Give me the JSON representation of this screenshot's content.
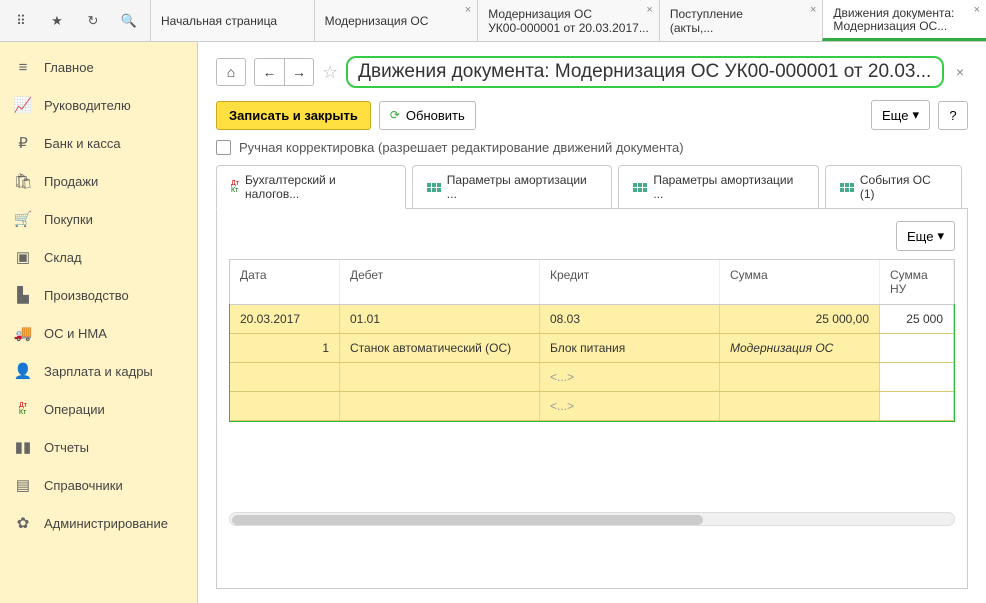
{
  "tabs": {
    "t0": {
      "l1": "Начальная страница",
      "l2": ""
    },
    "t1": {
      "l1": "Модернизация ОС",
      "l2": ""
    },
    "t2": {
      "l1": "Модернизация ОС",
      "l2": "УК00-000001 от 20.03.2017..."
    },
    "t3": {
      "l1": "Поступление",
      "l2": "(акты,..."
    },
    "t4": {
      "l1": "Движения документа:",
      "l2": "Модернизация ОС..."
    }
  },
  "sidebar": {
    "items": [
      {
        "label": "Главное",
        "icon": "≡"
      },
      {
        "label": "Руководителю",
        "icon": "↗"
      },
      {
        "label": "Банк и касса",
        "icon": "₽"
      },
      {
        "label": "Продажи",
        "icon": "🛍"
      },
      {
        "label": "Покупки",
        "icon": "🛒"
      },
      {
        "label": "Склад",
        "icon": "📦"
      },
      {
        "label": "Производство",
        "icon": "🏭"
      },
      {
        "label": "ОС и НМА",
        "icon": "🚚"
      },
      {
        "label": "Зарплата и кадры",
        "icon": "👤"
      },
      {
        "label": "Операции",
        "icon": "ДтКт"
      },
      {
        "label": "Отчеты",
        "icon": "📊"
      },
      {
        "label": "Справочники",
        "icon": "📁"
      },
      {
        "label": "Администрирование",
        "icon": "⚙"
      }
    ]
  },
  "page": {
    "title": "Движения документа: Модернизация ОС УК00-000001 от 20.03...",
    "save_close": "Записать и закрыть",
    "refresh": "Обновить",
    "more": "Еще",
    "help": "?",
    "manual_edit": "Ручная корректировка (разрешает редактирование движений документа)"
  },
  "subtabs": {
    "t0": "Бухгалтерский и налогов...",
    "t1": "Параметры амортизации ...",
    "t2": "Параметры амортизации ...",
    "t3": "События ОС (1)"
  },
  "table": {
    "more": "Еще",
    "headers": {
      "c1": "Дата",
      "c2": "Дебет",
      "c3": "Кредит",
      "c4": "Сумма",
      "c5": "Сумма НУ"
    },
    "r1": {
      "c1": "20.03.2017",
      "c2": "01.01",
      "c3": "08.03",
      "c4": "25 000,00",
      "c5": "25 000"
    },
    "r2": {
      "c1": "1",
      "c2": "Станок автоматический (ОС)",
      "c3": "Блок питания",
      "c4": "Модернизация ОС"
    },
    "r3": {
      "c3": "<...>"
    },
    "r4": {
      "c3": "<...>"
    }
  }
}
